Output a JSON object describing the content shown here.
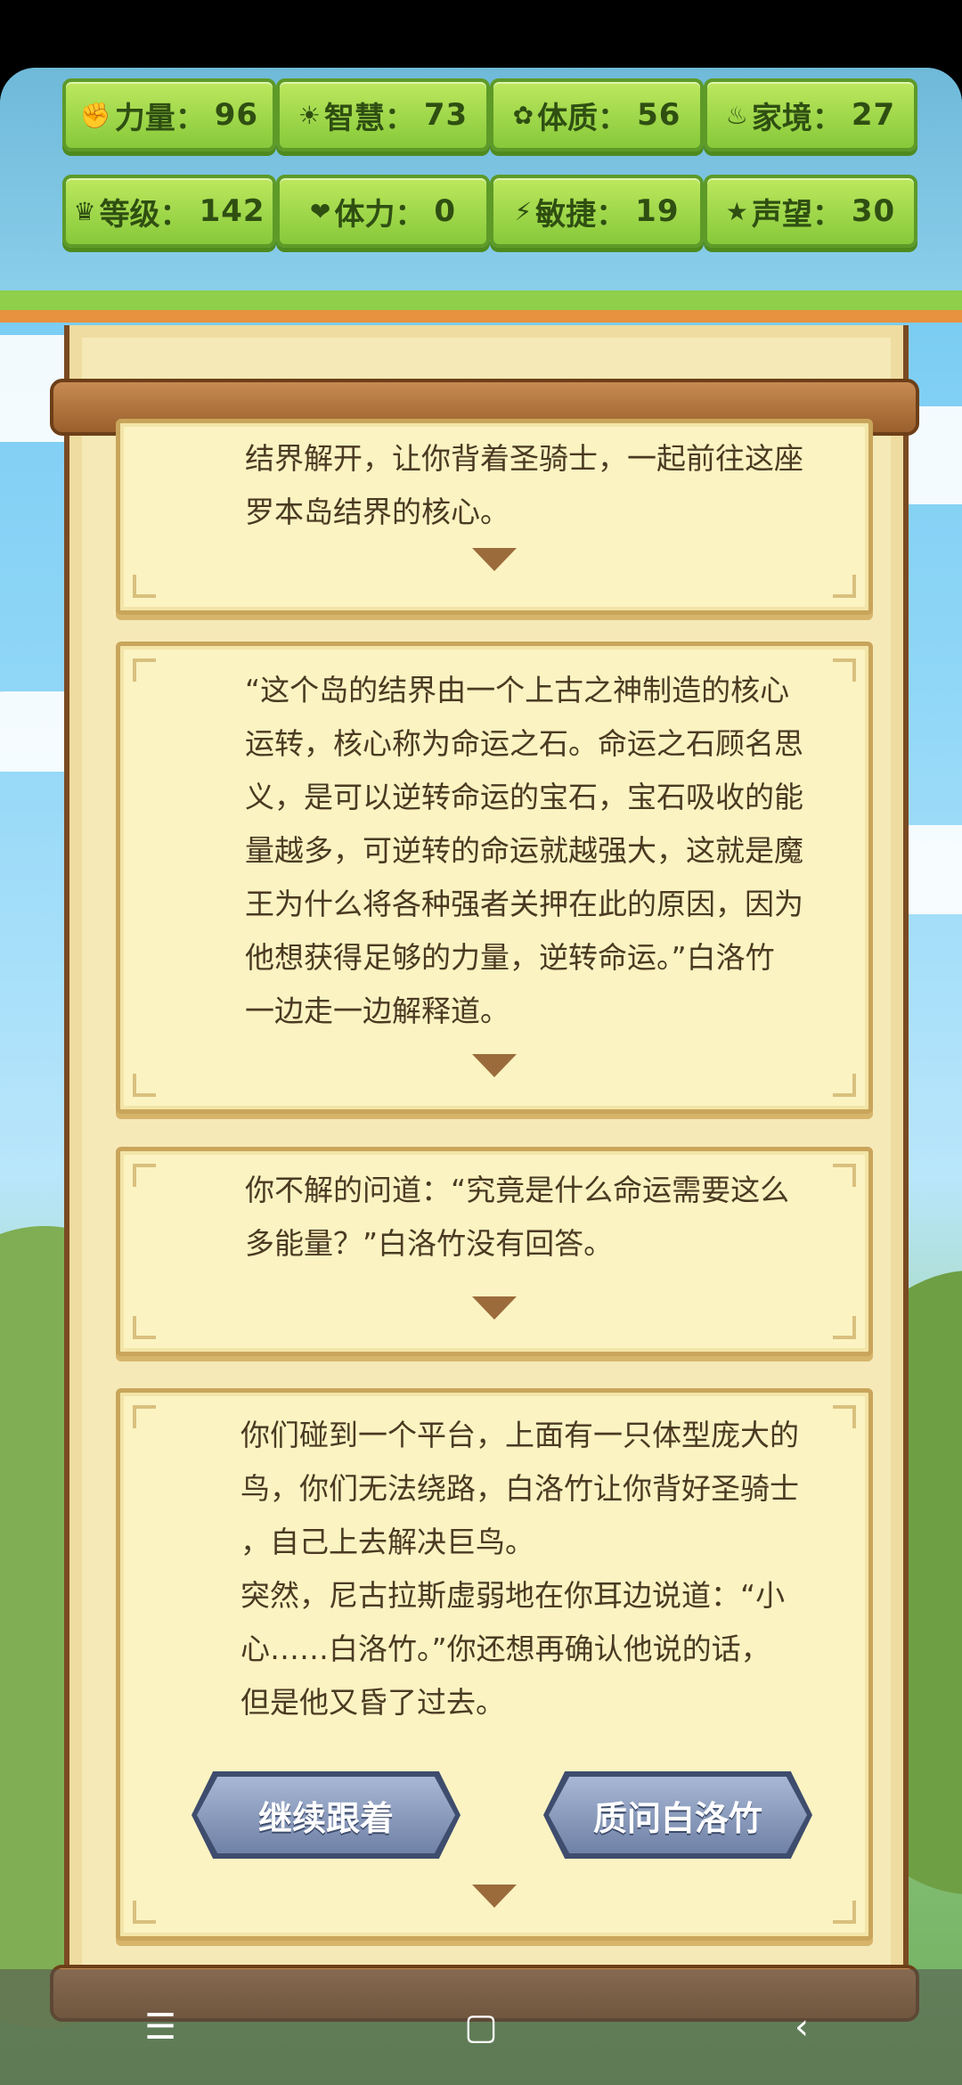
{
  "stats": [
    {
      "icon": "fist-icon",
      "glyph": "✊",
      "label": "力量：",
      "value": "96"
    },
    {
      "icon": "lightbulb-icon",
      "glyph": "☀",
      "label": "智慧：",
      "value": "73"
    },
    {
      "icon": "clover-icon",
      "glyph": "✿",
      "label": "体质：",
      "value": "56"
    },
    {
      "icon": "wealth-icon",
      "glyph": "♨",
      "label": "家境：",
      "value": "27"
    },
    {
      "icon": "crown-icon",
      "glyph": "♛",
      "label": "等级：",
      "value": "142"
    },
    {
      "icon": "heart-icon",
      "glyph": "❤",
      "label": "体力：",
      "value": "0"
    },
    {
      "icon": "lightning-icon",
      "glyph": "⚡",
      "label": "敏捷：",
      "value": "19"
    },
    {
      "icon": "star-icon",
      "glyph": "★",
      "label": "声望：",
      "value": "30"
    }
  ],
  "story": {
    "card1": "结界解开，让你背着圣骑士，一起前往这座\n罗本岛结界的核心。",
    "card2": "“这个岛的结界由一个上古之神制造的核心\n运转，核心称为命运之石。命运之石顾名思\n义，是可以逆转命运的宝石，宝石吸收的能\n量越多，可逆转的命运就越强大，这就是魔\n王为什么将各种强者关押在此的原因，因为\n他想获得足够的力量，逆转命运。”白洛竹\n一边走一边解释道。",
    "card3": "你不解的问道：“究竟是什么命运需要这么\n多能量？”白洛竹没有回答。",
    "card4": "你们碰到一个平台，上面有一只体型庞大的\n鸟，你们无法绕路，白洛竹让你背好圣骑士\n，自己上去解决巨鸟。\n突然，尼古拉斯虚弱地在你耳边说道：“小\n心……白洛竹。”你还想再确认他说的话，\n但是他又昏了过去。"
  },
  "choices": {
    "follow": "继续跟着",
    "question": "质问白洛竹"
  },
  "navbar": {
    "menu": "☰",
    "home": "▢",
    "back": "‹"
  }
}
